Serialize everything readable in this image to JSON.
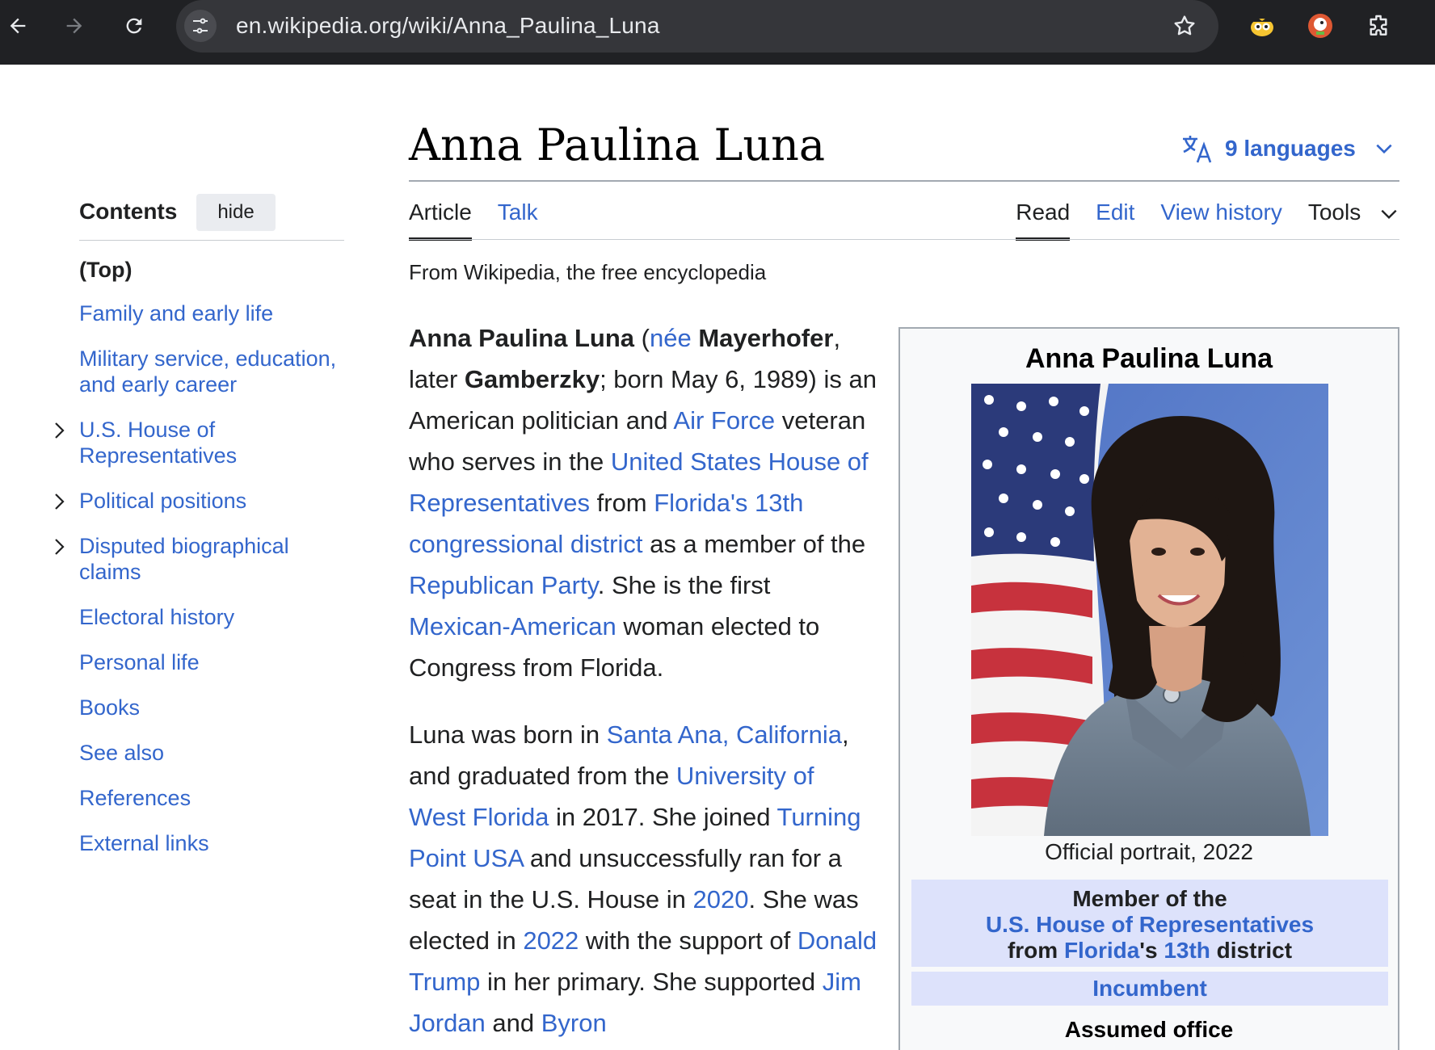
{
  "browser": {
    "url": "en.wikipedia.org/wiki/Anna_Paulina_Luna"
  },
  "toc": {
    "title": "Contents",
    "hide_label": "hide",
    "items": [
      {
        "label": "(Top)"
      },
      {
        "label": "Family and early life"
      },
      {
        "label": "Military service, education, and early career"
      },
      {
        "label": "U.S. House of Representatives"
      },
      {
        "label": "Political positions"
      },
      {
        "label": "Disputed biographical claims"
      },
      {
        "label": "Electoral history"
      },
      {
        "label": "Personal life"
      },
      {
        "label": "Books"
      },
      {
        "label": "See also"
      },
      {
        "label": "References"
      },
      {
        "label": "External links"
      }
    ]
  },
  "header": {
    "title": "Anna Paulina Luna",
    "languages_label": "9 languages"
  },
  "tabs": {
    "article": "Article",
    "talk": "Talk",
    "read": "Read",
    "edit": "Edit",
    "view_history": "View history",
    "tools": "Tools"
  },
  "tagline": "From Wikipedia, the free encyclopedia",
  "article": {
    "p1": [
      {
        "t": "Anna Paulina Luna",
        "b": true
      },
      {
        "t": " ("
      },
      {
        "t": "née",
        "link": true
      },
      {
        "t": " "
      },
      {
        "t": "Mayerhofer",
        "b": true
      },
      {
        "t": ", later "
      },
      {
        "t": "Gamberzky",
        "b": true
      },
      {
        "t": "; born May 6, 1989) is an American politician and "
      },
      {
        "t": "Air Force",
        "link": true
      },
      {
        "t": " veteran who serves in the "
      },
      {
        "t": "United States House of Representatives",
        "link": true
      },
      {
        "t": " from "
      },
      {
        "t": "Florida's 13th congressional district",
        "link": true
      },
      {
        "t": " as a member of the "
      },
      {
        "t": "Republican Party",
        "link": true
      },
      {
        "t": ". She is the first "
      },
      {
        "t": "Mexican-American",
        "link": true
      },
      {
        "t": " woman elected to Congress from Florida."
      }
    ],
    "p2": [
      {
        "t": "Luna was born in "
      },
      {
        "t": "Santa Ana, California",
        "link": true
      },
      {
        "t": ", and graduated from the "
      },
      {
        "t": "University of West Florida",
        "link": true
      },
      {
        "t": " in 2017. She joined "
      },
      {
        "t": "Turning Point USA",
        "link": true
      },
      {
        "t": " and unsuccessfully ran for a seat in the U.S. House in "
      },
      {
        "t": "2020",
        "link": true
      },
      {
        "t": ". She was elected in "
      },
      {
        "t": "2022",
        "link": true
      },
      {
        "t": " with the support of "
      },
      {
        "t": "Donald Trump",
        "link": true
      },
      {
        "t": " in her primary. She supported "
      },
      {
        "t": "Jim Jordan",
        "link": true
      },
      {
        "t": " and "
      },
      {
        "t": "Byron",
        "link": true
      }
    ]
  },
  "infobox": {
    "name": "Anna Paulina Luna",
    "caption": "Official portrait, 2022",
    "office_line1": "Member of the",
    "office_link": "U.S. House of Representatives",
    "office_from": "from ",
    "office_state": "Florida",
    "office_apos": "'s ",
    "office_district": "13th",
    "office_tail": " district",
    "incumbent": "Incumbent",
    "assumed_office": "Assumed office"
  },
  "colors": {
    "link": "#3366cc",
    "chrome_bg": "#202124",
    "infobox_header": "#dde2fb"
  },
  "icons": [
    "back-icon",
    "forward-icon",
    "reload-icon",
    "site-settings-icon",
    "bookmark-star-icon",
    "extension-icon",
    "translate-icon",
    "chevron-down-icon",
    "chevron-right-icon"
  ]
}
